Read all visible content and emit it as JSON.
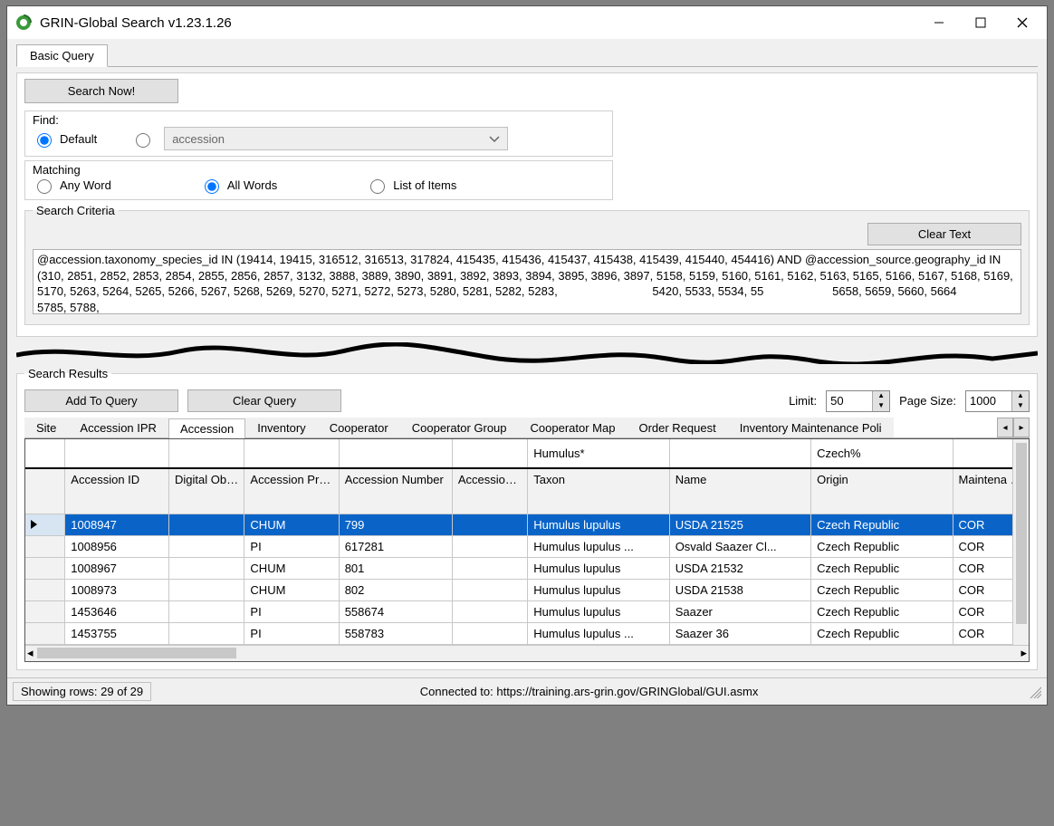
{
  "title": "GRIN-Global Search v1.23.1.26",
  "main_tab": "Basic Query",
  "search_now": "Search Now!",
  "find": {
    "label": "Find:",
    "default": "Default",
    "combo_value": "accession"
  },
  "matching": {
    "label": "Matching",
    "any": "Any Word",
    "all": "All Words",
    "list": "List of Items"
  },
  "criteria": {
    "legend": "Search Criteria",
    "clear": "Clear Text",
    "text": "@accession.taxonomy_species_id IN (19414, 19415, 316512, 316513, 317824, 415435, 415436, 415437, 415438, 415439, 415440, 454416) AND @accession_source.geography_id IN (310, 2851, 2852, 2853, 2854, 2855, 2856, 2857, 3132, 3888, 3889, 3890, 3891, 3892, 3893, 3894, 3895, 3896, 3897, 5158, 5159, 5160, 5161, 5162, 5163, 5165, 5166, 5167, 5168, 5169, 5170, 5263, 5264, 5265, 5266, 5267, 5268, 5269, 5270, 5271, 5272, 5273, 5280, 5281, 5282, 5283,                             5420, 5533, 5534, 55                     5658, 5659, 5660, 5664                         5785, 5788,"
  },
  "results": {
    "legend": "Search Results",
    "add": "Add To Query",
    "clear": "Clear Query",
    "limit_label": "Limit:",
    "limit_value": "50",
    "pagesize_label": "Page Size:",
    "pagesize_value": "1000",
    "tabs": [
      "Site",
      "Accession IPR",
      "Accession",
      "Inventory",
      "Cooperator",
      "Cooperator Group",
      "Cooperator Map",
      "Order Request",
      "Inventory Maintenance Poli"
    ],
    "active_tab_index": 2,
    "filters": {
      "taxon": "Humulus*",
      "origin": "Czech%"
    },
    "columns": [
      "Accession ID",
      "Digital Object Identifier",
      "Accession Prefix",
      "Accession Number",
      "Accession Suffix",
      "Taxon",
      "Name",
      "Origin",
      "Maintena Site"
    ],
    "rows": [
      {
        "sel": true,
        "id": "1008947",
        "doi": "",
        "prefix": "CHUM",
        "num": "799",
        "suffix": "",
        "taxon": "Humulus lupulus",
        "name": "USDA 21525",
        "origin": "Czech Republic",
        "site": "COR"
      },
      {
        "sel": false,
        "id": "1008956",
        "doi": "",
        "prefix": "PI",
        "num": "617281",
        "suffix": "",
        "taxon": "Humulus lupulus ...",
        "name": "Osvald Saazer Cl...",
        "origin": "Czech Republic",
        "site": "COR"
      },
      {
        "sel": false,
        "id": "1008967",
        "doi": "",
        "prefix": "CHUM",
        "num": "801",
        "suffix": "",
        "taxon": "Humulus lupulus",
        "name": "USDA 21532",
        "origin": "Czech Republic",
        "site": "COR"
      },
      {
        "sel": false,
        "id": "1008973",
        "doi": "",
        "prefix": "CHUM",
        "num": "802",
        "suffix": "",
        "taxon": "Humulus lupulus",
        "name": "USDA 21538",
        "origin": "Czech Republic",
        "site": "COR"
      },
      {
        "sel": false,
        "id": "1453646",
        "doi": "",
        "prefix": "PI",
        "num": "558674",
        "suffix": "",
        "taxon": "Humulus lupulus",
        "name": "Saazer",
        "origin": "Czech Republic",
        "site": "COR"
      },
      {
        "sel": false,
        "id": "1453755",
        "doi": "",
        "prefix": "PI",
        "num": "558783",
        "suffix": "",
        "taxon": "Humulus lupulus ...",
        "name": "Saazer 36",
        "origin": "Czech Republic",
        "site": "COR"
      }
    ]
  },
  "status": {
    "rows": "Showing rows: 29 of 29",
    "conn": "Connected to: https://training.ars-grin.gov/GRINGlobal/GUI.asmx"
  }
}
